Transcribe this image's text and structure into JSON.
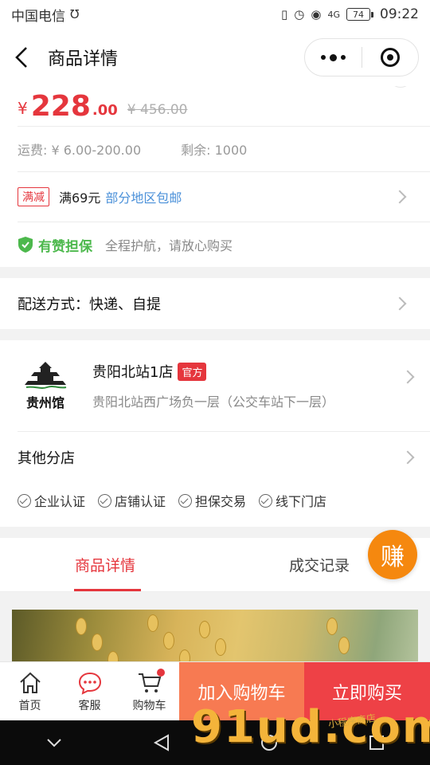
{
  "status_bar": {
    "carrier": "中国电信",
    "network": "4G",
    "battery": "74",
    "time": "09:22"
  },
  "nav": {
    "title": "商品详情"
  },
  "price": {
    "currency": "¥",
    "integer": "228",
    "decimal": ".00",
    "original": "¥ 456.00"
  },
  "meta": {
    "shipping": "运费: ¥ 6.00-200.00",
    "stock": "剩余: 1000"
  },
  "promo": {
    "tag": "满减",
    "text": "满69元",
    "link": "部分地区包邮"
  },
  "guarantee": {
    "title": "有赞担保",
    "text": "全程护航，请放心购买"
  },
  "delivery": {
    "label": "配送方式：快递、自提"
  },
  "store": {
    "logo_text": "贵州馆",
    "name": "贵阳北站1店",
    "badge": "官方",
    "address": "贵阳北站西广场负一层（公交车站下一层）",
    "other_label": "其他分店",
    "certs": [
      "企业认证",
      "店铺认证",
      "担保交易",
      "线下门店"
    ]
  },
  "tabs": {
    "active": "商品详情",
    "inactive": "成交记录",
    "earn": "赚"
  },
  "bottom_bar": {
    "home": "首页",
    "service": "客服",
    "cart": "购物车",
    "add_to_cart": "加入购物车",
    "buy_now": "立即购买"
  },
  "watermark": {
    "main": "91ud.com",
    "small": "小程序商店"
  },
  "colors": {
    "accent_red": "#e5363d",
    "orange": "#f77a52",
    "green": "#4cb84c",
    "link_blue": "#4a90d9",
    "earn_orange": "#f5880f"
  }
}
